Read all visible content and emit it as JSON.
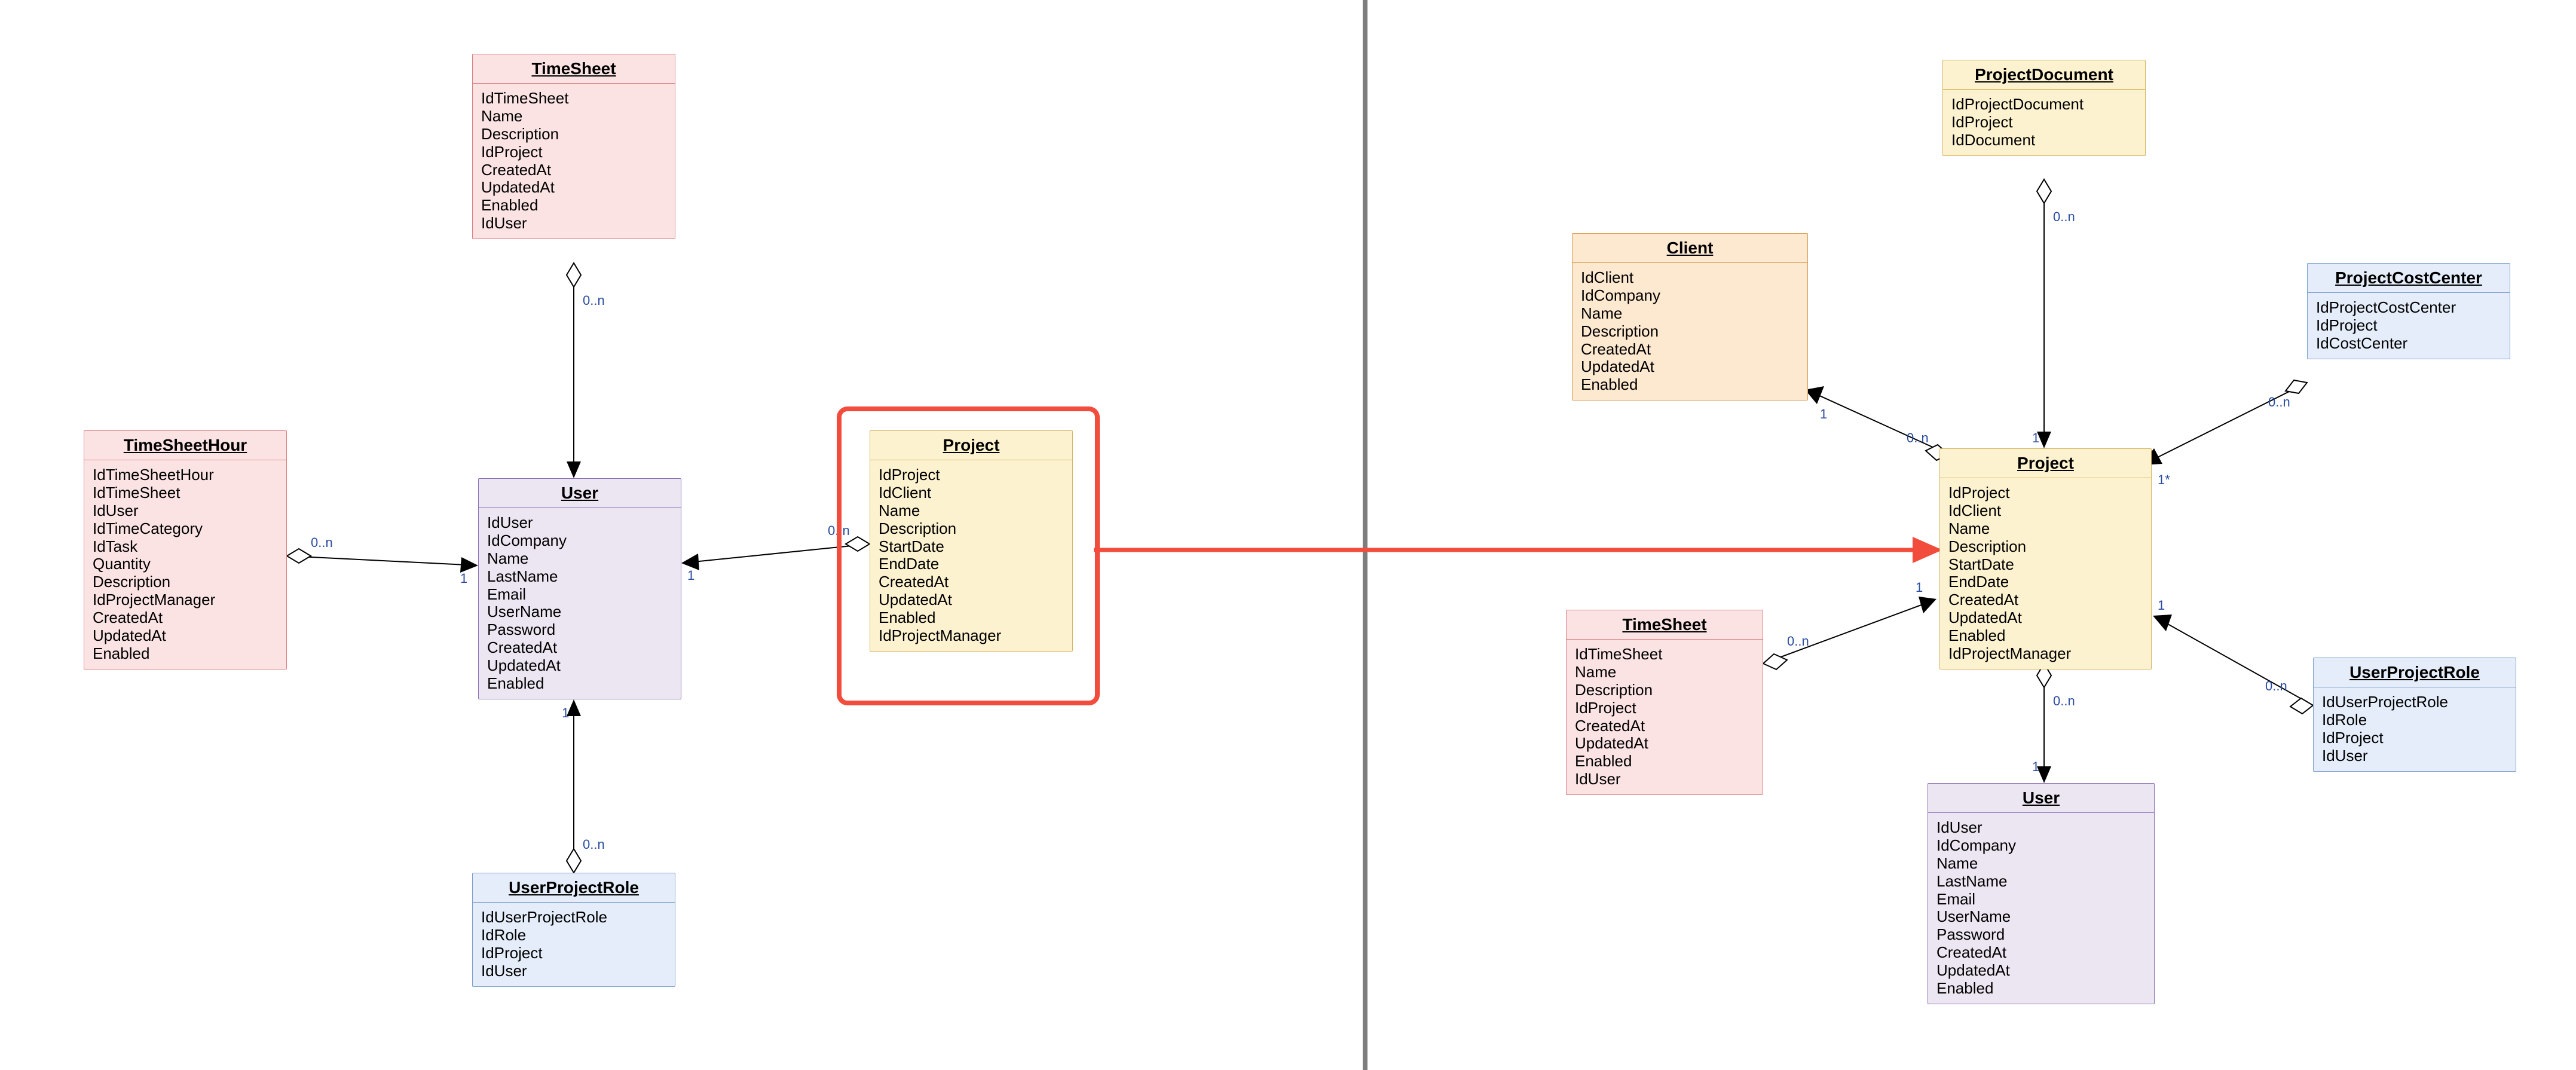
{
  "left": {
    "TimeSheet": {
      "title": "TimeSheet",
      "attrs": [
        "IdTimeSheet",
        "Name",
        "Description",
        "IdProject",
        "CreatedAt",
        "UpdatedAt",
        "Enabled",
        "IdUser"
      ]
    },
    "TimeSheetHour": {
      "title": "TimeSheetHour",
      "attrs": [
        "IdTimeSheetHour",
        "IdTimeSheet",
        "IdUser",
        "IdTimeCategory",
        "IdTask",
        "Quantity",
        "Description",
        "IdProjectManager",
        "CreatedAt",
        "UpdatedAt",
        "Enabled"
      ]
    },
    "User": {
      "title": "User",
      "attrs": [
        "IdUser",
        "IdCompany",
        "Name",
        "LastName",
        "Email",
        "UserName",
        "Password",
        "CreatedAt",
        "UpdatedAt",
        "Enabled"
      ]
    },
    "UserProjectRole": {
      "title": "UserProjectRole",
      "attrs": [
        "IdUserProjectRole",
        "IdRole",
        "IdProject",
        "IdUser"
      ]
    },
    "Project": {
      "title": "Project",
      "attrs": [
        "IdProject",
        "IdClient",
        "Name",
        "Description",
        "StartDate",
        "EndDate",
        "CreatedAt",
        "UpdatedAt",
        "Enabled",
        "IdProjectManager"
      ]
    }
  },
  "right": {
    "ProjectDocument": {
      "title": "ProjectDocument",
      "attrs": [
        "IdProjectDocument",
        "IdProject",
        "IdDocument"
      ]
    },
    "Client": {
      "title": "Client",
      "attrs": [
        "IdClient",
        "IdCompany",
        "Name",
        "Description",
        "CreatedAt",
        "UpdatedAt",
        "Enabled"
      ]
    },
    "ProjectCostCenter": {
      "title": "ProjectCostCenter",
      "attrs": [
        "IdProjectCostCenter",
        "IdProject",
        "IdCostCenter"
      ]
    },
    "TimeSheet": {
      "title": "TimeSheet",
      "attrs": [
        "IdTimeSheet",
        "Name",
        "Description",
        "IdProject",
        "CreatedAt",
        "UpdatedAt",
        "Enabled",
        "IdUser"
      ]
    },
    "Project": {
      "title": "Project",
      "attrs": [
        "IdProject",
        "IdClient",
        "Name",
        "Description",
        "StartDate",
        "EndDate",
        "CreatedAt",
        "UpdatedAt",
        "Enabled",
        "IdProjectManager"
      ]
    },
    "UserProjectRole": {
      "title": "UserProjectRole",
      "attrs": [
        "IdUserProjectRole",
        "IdRole",
        "IdProject",
        "IdUser"
      ]
    },
    "User": {
      "title": "User",
      "attrs": [
        "IdUser",
        "IdCompany",
        "Name",
        "LastName",
        "Email",
        "UserName",
        "Password",
        "CreatedAt",
        "UpdatedAt",
        "Enabled"
      ]
    }
  },
  "cardinality": {
    "one": "1",
    "many": "0..n",
    "onestar": "1*"
  },
  "chart_data": {
    "type": "diagram",
    "subtype": "uml-aggregation",
    "description": "Two UML-style entity diagrams side-by-side. Left diagram centers on User; right diagram centers on Project. A red highlight box surrounds left Project, with a red arrow to right Project indicating context switch.",
    "left_panel": {
      "center": "User",
      "entities": [
        "TimeSheet",
        "TimeSheetHour",
        "User",
        "UserProjectRole",
        "Project"
      ],
      "relations": [
        {
          "from": "TimeSheet",
          "to": "User",
          "type": "aggregation",
          "from_card": "0..n",
          "to_card": "1"
        },
        {
          "from": "TimeSheetHour",
          "to": "User",
          "type": "aggregation",
          "from_card": "0..n",
          "to_card": "1"
        },
        {
          "from": "UserProjectRole",
          "to": "User",
          "type": "aggregation",
          "from_card": "0..n",
          "to_card": "1"
        },
        {
          "from": "Project",
          "to": "User",
          "type": "aggregation",
          "from_card": "0..n",
          "to_card": "1"
        }
      ],
      "highlighted": "Project"
    },
    "right_panel": {
      "center": "Project",
      "entities": [
        "ProjectDocument",
        "Client",
        "ProjectCostCenter",
        "TimeSheet",
        "Project",
        "UserProjectRole",
        "User"
      ],
      "relations": [
        {
          "from": "ProjectDocument",
          "to": "Project",
          "type": "aggregation",
          "from_card": "0..n",
          "to_card": "1"
        },
        {
          "from": "Project",
          "to": "Client",
          "type": "aggregation",
          "from_card": "0..n",
          "to_card": "1"
        },
        {
          "from": "ProjectCostCenter",
          "to": "Project",
          "type": "aggregation",
          "from_card": "0..n",
          "to_card": "1*"
        },
        {
          "from": "TimeSheet",
          "to": "Project",
          "type": "aggregation",
          "from_card": "0..n",
          "to_card": "1"
        },
        {
          "from": "UserProjectRole",
          "to": "Project",
          "type": "aggregation",
          "from_card": "0..n",
          "to_card": "1"
        },
        {
          "from": "Project",
          "to": "User",
          "type": "aggregation",
          "from_card": "0..n",
          "to_card": "1"
        }
      ]
    },
    "cross_arrow": {
      "from": "left.Project",
      "to": "right.Project",
      "color": "#f24c3d"
    }
  }
}
